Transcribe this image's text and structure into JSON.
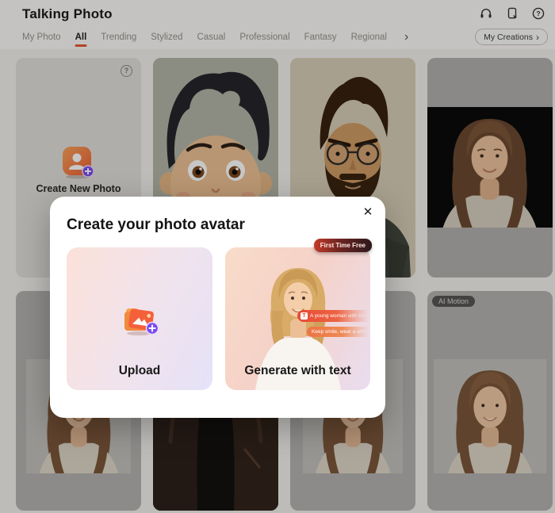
{
  "header": {
    "title": "Talking Photo",
    "icons": [
      {
        "name": "headset-icon"
      },
      {
        "name": "mobile-app-icon"
      },
      {
        "name": "help-icon"
      }
    ]
  },
  "tabs": {
    "items": [
      {
        "label": "My Photo",
        "active": false
      },
      {
        "label": "All",
        "active": true
      },
      {
        "label": "Trending",
        "active": false
      },
      {
        "label": "Stylized",
        "active": false
      },
      {
        "label": "Casual",
        "active": false
      },
      {
        "label": "Professional",
        "active": false
      },
      {
        "label": "Fantasy",
        "active": false
      },
      {
        "label": "Regional",
        "active": false
      }
    ],
    "more_glyph": "›",
    "my_creations_label": "My Creations",
    "my_creations_arrow": "›"
  },
  "grid": {
    "create_card": {
      "label": "Create New Photo",
      "help_glyph": "?"
    },
    "ai_motion_badge": "AI Motion"
  },
  "modal": {
    "close_glyph": "✕",
    "title": "Create your photo avatar",
    "upload": {
      "label": "Upload"
    },
    "generate": {
      "label": "Generate with text",
      "badge": "First Time Free",
      "prompt_icon": "T",
      "prompts": [
        "A young woman with blonde ha",
        "Keep smile, wear a white shi"
      ]
    }
  },
  "colors": {
    "accent": "#e05a35",
    "badge_start": "#c23a28",
    "badge_end": "#2c181c",
    "plus_purple": "#7a4bf0"
  }
}
